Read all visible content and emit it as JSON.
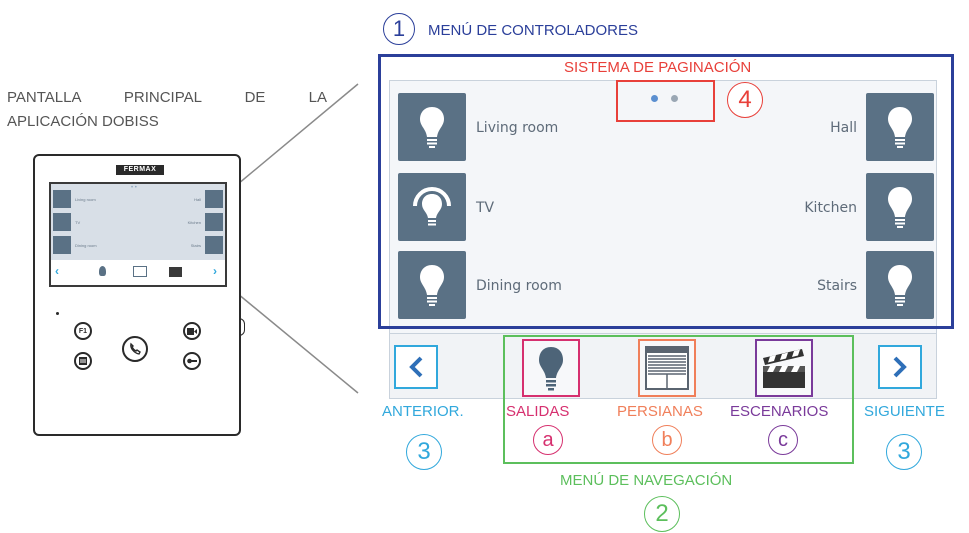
{
  "device": {
    "caption_line1": "PANTALLA PRINCIPAL DE LA",
    "caption_line2": "APLICACIÓN DOBISS",
    "brand": "FERMAX",
    "mini_labels": [
      "Living room",
      "Hall",
      "TV",
      "Kitchen",
      "Dining room",
      "Stairs"
    ],
    "buttons": [
      "F1",
      "camera",
      "menu",
      "phone",
      "key"
    ]
  },
  "controllers_menu": {
    "number": "1",
    "label": "MENÚ DE CONTROLADORES"
  },
  "pagination": {
    "number": "4",
    "label": "SISTEMA DE PAGINACIÓN"
  },
  "rooms": {
    "left": [
      "Living room",
      "TV",
      "Dining room"
    ],
    "right": [
      "Hall",
      "Kitchen",
      "Stairs"
    ]
  },
  "nav_menu": {
    "number": "2",
    "label": "MENÚ DE NAVEGACIÓN"
  },
  "previous": {
    "number": "3",
    "label": "ANTERIOR."
  },
  "next": {
    "number": "3",
    "label": "SIGUIENTE"
  },
  "nav_items": [
    {
      "label": "SALIDAS",
      "letter": "a",
      "color": "#d6306f",
      "icon": "bulb-icon"
    },
    {
      "label": "PERSIANAS",
      "letter": "b",
      "color": "#f07f5a",
      "icon": "blinds-icon"
    },
    {
      "label": "ESCENARIOS",
      "letter": "c",
      "color": "#7a3a9a",
      "icon": "clapperboard-icon"
    }
  ],
  "colors": {
    "controllers": "#2b3f9a",
    "pagination": "#e8403a",
    "navigation": "#5cbf5c",
    "arrows": "#31a8dc",
    "tile": "#5a7185"
  }
}
